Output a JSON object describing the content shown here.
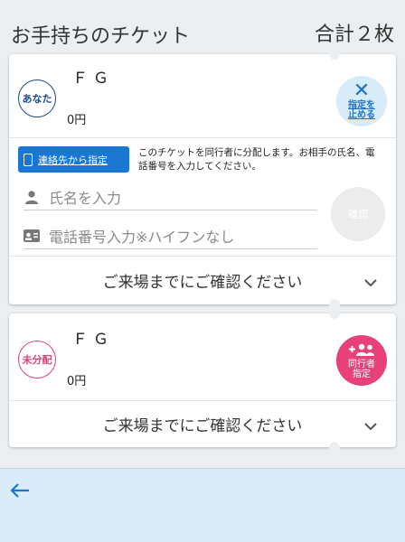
{
  "header": {
    "title": "お手持ちのチケット",
    "total": "合計２枚"
  },
  "tickets": [
    {
      "badge": "あなた",
      "name": "ＦＧ",
      "price": "0円",
      "action_label_line1": "指定を",
      "action_label_line2": "止める",
      "contact_button": "連絡先から指定",
      "info_text": "このチケットを同行者に分配します。お相手の氏名、電話番号を入力してください。",
      "name_placeholder": "氏名を入力",
      "phone_placeholder": "電話番号入力※ハイフンなし",
      "confirm_button": "確認",
      "notice": "ご来場までにご確認ください"
    },
    {
      "badge": "未分配",
      "name": "ＦＧ",
      "price": "0円",
      "action_label_line1": "同行者",
      "action_label_line2": "指定",
      "notice": "ご来場までにご確認ください"
    }
  ],
  "colors": {
    "accent_blue": "#1976d2",
    "accent_pink": "#e8407a",
    "footer_bg": "#d9ecf8"
  },
  "icons": [
    "close-icon",
    "phone-book-icon",
    "person-icon",
    "id-card-icon",
    "chevron-down-icon",
    "add-people-icon",
    "back-arrow-icon"
  ]
}
